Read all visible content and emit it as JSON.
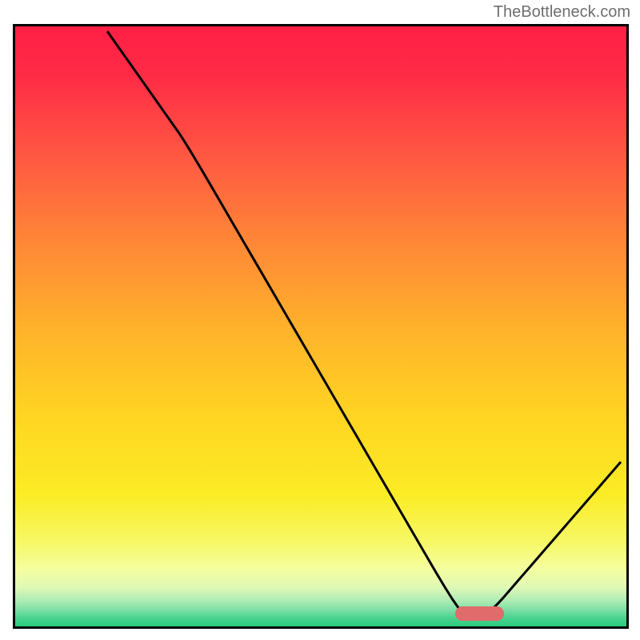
{
  "watermark": "TheBottleneck.com",
  "chart_data": {
    "type": "line",
    "title": "",
    "xlabel": "",
    "ylabel": "",
    "xlim": [
      0,
      100
    ],
    "ylim": [
      0,
      100
    ],
    "curve_points": [
      {
        "x": 14.5,
        "y": 100
      },
      {
        "x": 28.0,
        "y": 80.5
      },
      {
        "x": 72.5,
        "y": 2.6
      },
      {
        "x": 78.0,
        "y": 2.6
      },
      {
        "x": 100.0,
        "y": 28.5
      }
    ],
    "optimum_marker": {
      "x_start": 72.0,
      "x_end": 80.0,
      "y": 2.1
    },
    "gradient_stops": [
      {
        "offset": 0.0,
        "color": "#ff1f44"
      },
      {
        "offset": 0.08,
        "color": "#ff2b46"
      },
      {
        "offset": 0.2,
        "color": "#ff5243"
      },
      {
        "offset": 0.35,
        "color": "#ff8438"
      },
      {
        "offset": 0.5,
        "color": "#ffb12b"
      },
      {
        "offset": 0.65,
        "color": "#ffd522"
      },
      {
        "offset": 0.78,
        "color": "#fbec25"
      },
      {
        "offset": 0.86,
        "color": "#f6f867"
      },
      {
        "offset": 0.905,
        "color": "#f5fea0"
      },
      {
        "offset": 0.935,
        "color": "#dff8b5"
      },
      {
        "offset": 0.955,
        "color": "#b3edb6"
      },
      {
        "offset": 0.972,
        "color": "#7fe0a6"
      },
      {
        "offset": 0.985,
        "color": "#4cd48f"
      },
      {
        "offset": 1.0,
        "color": "#2bcb7f"
      }
    ]
  }
}
